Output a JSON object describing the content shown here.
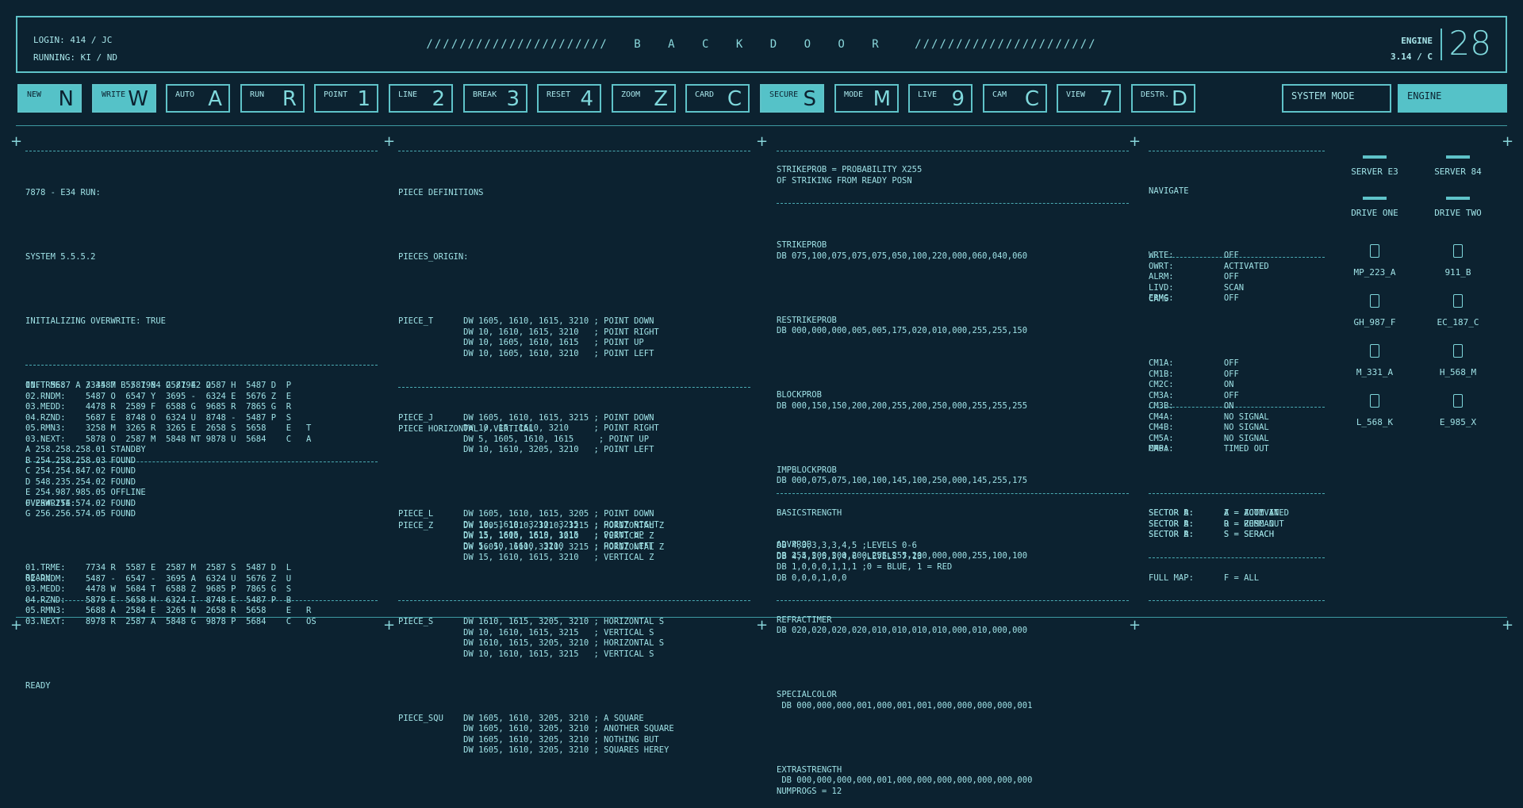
{
  "header": {
    "login": "LOGIN: 414 / JC",
    "running": "RUNNING: KI / ND",
    "title_left": "//////////////////////",
    "title": "B A C K D O O R",
    "title_right": "//////////////////////",
    "engine_label": "ENGINE",
    "engine_version": "3.14 / C",
    "engine_number": "28"
  },
  "fkeys": [
    {
      "label": "NEW",
      "key": "N",
      "active": true
    },
    {
      "label": "WRITE",
      "key": "W",
      "active": true
    },
    {
      "label": "AUTO",
      "key": "A",
      "active": false
    },
    {
      "label": "RUN",
      "key": "R",
      "active": false
    },
    {
      "label": "POINT",
      "key": "1",
      "active": false
    },
    {
      "label": "LINE",
      "key": "2",
      "active": false
    },
    {
      "label": "BREAK",
      "key": "3",
      "active": false
    },
    {
      "label": "RESET",
      "key": "4",
      "active": false
    },
    {
      "label": "ZOOM",
      "key": "Z",
      "active": false
    },
    {
      "label": "CARD",
      "key": "C",
      "active": false
    },
    {
      "label": "SECURE",
      "key": "S",
      "active": true
    },
    {
      "label": "MODE",
      "key": "M",
      "active": false
    },
    {
      "label": "LIVE",
      "key": "9",
      "active": false
    },
    {
      "label": "CAM",
      "key": "C",
      "active": false
    },
    {
      "label": "VIEW",
      "key": "7",
      "active": false
    },
    {
      "label": "DESTR.",
      "key": "D",
      "active": false
    }
  ],
  "modes": {
    "system_mode": "SYSTEM MODE",
    "engine": "ENGINE"
  },
  "col1": {
    "line1": "7878 - E34 RUN:",
    "line2": "SYSTEM 5.5.5.2",
    "line3": "INITIALIZING OVERWRITE: TRUE",
    "line4": "INF: 5687 A / 4587 B / 1984 G /1942 O",
    "ips": "A 258.258.258.01 STANDBY\nB 254.258.258.03 FOUND\nC 254.254.847.02 FOUND\nD 548.235.254.02 FOUND\nE 254.987.985.05 OFFLINE\nF 254.254.574.02 FOUND\nG 256.256.574.05 FOUND",
    "ready1": "READY",
    "table1": "01.TRME:    3334 M  5587 N  2587 E  2587 H  5487 D  P\n02.RNDM:    5487 O  6547 Y  3695 -  6324 E  5676 Z  E\n03.MEDD:    4478 R  2589 F  6588 G  9685 R  7865 G  R\n04.RZND:    5687 E  8748 O  6324 U  8748 -  5487 P  S\n05.RMN3:    3258 M  3265 R  3265 E  2658 S  5658    E   T\n03.NEXT:    5878 O  2587 M  5848 NT 9878 U  5684    C   A",
    "overwrite": "OVERWRITE:",
    "table2": "01.TRME:    7734 R  5587 E  2587 M  2587 S  5487 D  L\n02.RNDM:    5487 -  6547 -  3695 A  6324 U  5676 Z  U\n03.MEDD:    4478 W  5684 T  6588 Z  9685 P  7865 G  S\n04.RZND:    5879 E  5658 H  6324 I  8748 E  5487 P  B\n05.RMN3:    5688 A  2584 E  3265 N  2658 R  5658    E   R\n03.NEXT:    8978 R  2587 A  5848 G  9878 P  5684    C   OS",
    "ready2": "READY"
  },
  "col2": {
    "h1": "PIECE DEFINITIONS",
    "h2": "PIECES_ORIGIN:",
    "piece_t": "PIECE_T      DW 1605, 1610, 1615, 3210 ; POINT DOWN\n             DW 10, 1610, 1615, 3210   ; POINT RIGHT\n             DW 10, 1605, 1610, 1615   ; POINT UP\n             DW 10, 1605, 1610, 3210   ; POINT LEFT",
    "piece_j": "PIECE_J      DW 1605, 1610, 1615, 3215 ; POINT DOWN\n             DW 10, 15, 1610, 3210     ; POINT RIGHT\n             DW 5, 1605, 1610, 1615     ; POINT UP\n             DW 10, 1610, 3205, 3210   ; POINT LEFT",
    "piece_l": "PIECE_L      DW 1605, 1610, 1615, 3205 ; POINT DOWN\n             DW 10, 1610, 3210, 3215   ; POINT RIGHT\n             DW 15, 1605, 1610, 1615   ; POINT UP\n             DW 5, 10, 1610, 3210      ; POINT LEFT",
    "h3": "PIECE HORIZONTAL / VERTICAL",
    "piece_z": "PIECE_Z      DW 1605, 1610, 3210, 3215 ; HORIZONTAL Z\n             DW 15, 1610, 1615, 3210   ; VERTICAL Z\n             DW 1605, 1610, 3210, 3215 ; HORIZONTAL Z\n             DW 15, 1610, 1615, 3210   ; VERTICAL Z",
    "piece_s": "PIECE_S      DW 1610, 1615, 3205, 3210 ; HORIZONTAL S\n             DW 10, 1610, 1615, 3215   ; VERTICAL S\n             DW 1610, 1615, 3205, 3210 ; HORIZONTAL S\n             DW 10, 1610, 1615, 3215   ; VERTICAL S",
    "piece_squ": "PIECE_SQU    DW 1605, 1610, 3205, 3210 ; A SQUARE\n             DW 1605, 1610, 3205, 3210 ; ANOTHER SQUARE\n             DW 1605, 1610, 3205, 3210 ; NOTHING BUT\n             DW 1605, 1610, 3205, 3210 ; SQUARES HEREY"
  },
  "col3": {
    "intro": "STRIKEPROB = PROBABILITY X255\nOF STRIKING FROM READY POSN",
    "strikeprob": "STRIKEPROB\nDB 075,100,075,075,075,050,100,220,000,060,040,060",
    "restrikeprob": "RESTRIKEPROB\nDB 000,000,000,005,005,175,020,010,000,255,255,150",
    "blockprob": "BLOCKPROB\nDB 000,150,150,200,200,255,200,250,000,255,255,255",
    "impblockprob": "IMPBLOCKPROB\nDB 000,075,075,100,100,145,100,250,000,145,255,175",
    "advprob": "ADVPROB\nDB 255,200,200,200,255,255,200,000,000,255,100,100",
    "refractimer": "REFRACTIMER\nDB 020,020,020,020,010,010,010,010,000,010,000,000",
    "specialcolor": "SPECIALCOLOR\n DB 000,000,000,001,000,001,001,000,000,000,000,001",
    "extrastrength": "EXTRASTRENGTH\n DB 000,000,000,000,001,000,000,000,000,000,000,000\nNUMPROGS = 12",
    "basicstrength": "BASICSTRENGTH",
    "levels": "DB 4,3,3,3,3,4,5 ;LEVELS 0-6\nDB 4,4,5,5,5,4,6 ;LEVELS 7-13\nDB 1,0,0,0,1,1,1 ;0 = BLUE, 1 = RED\nDB 0,0,0,1,0,0"
  },
  "col4": {
    "navigate": "NAVIGATE",
    "nav_list": "WRTE:          OFF\nOWRT:          ACTIVATED\nALRM:          OFF\nLIVD:          SCAN\nERMG:          OFF",
    "cams": "CAMS",
    "cam_list": "CM1A:          OFF\nCM1B:          OFF\nCM2C:          ON\nCM3A:          OFF\nCM3B:          ON\nCM4A:          NO SIGNAL\nCM4B:          NO SIGNAL\nCM5A:          NO SIGNAL\nCM6A:          TIMED OUT",
    "map": "MAP:",
    "sector_a": "SECTOR A:      Z = ZOOM IN\nSECTOR A:      O = ZOMM OUT\nSECTOR A:      S = SERACH",
    "sector_b": "SECTOR B:      A = ACTIVATED\nSECTOR B:      R = RESCAN\nSECTOR B:      S = SERACH",
    "full_map": "FULL MAP:      F = ALL"
  },
  "servers": [
    {
      "label": "SERVER  E3"
    },
    {
      "label": "SERVER  84"
    },
    {
      "label": "DRIVE ONE"
    },
    {
      "label": "DRIVE  TWO"
    }
  ],
  "cams_grid": [
    {
      "label": "MP_223_A"
    },
    {
      "label": "911_B"
    },
    {
      "label": "GH_987_F"
    },
    {
      "label": "EC_187_C"
    },
    {
      "label": "M_331_A"
    },
    {
      "label": "H_568_M"
    },
    {
      "label": "L_568_K"
    },
    {
      "label": "E_985_X"
    }
  ]
}
